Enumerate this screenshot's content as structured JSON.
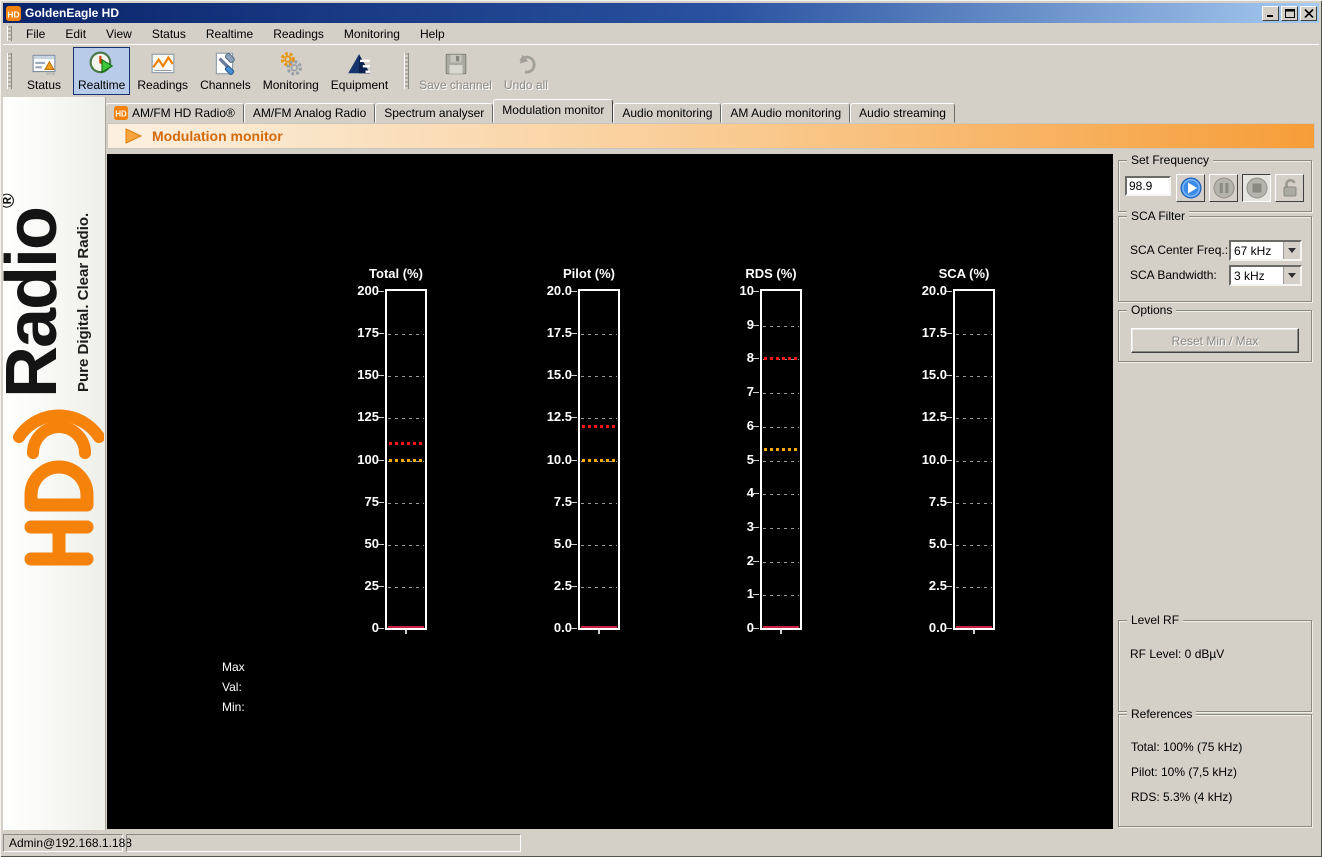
{
  "window": {
    "title": "GoldenEagle HD"
  },
  "menu": {
    "items": [
      "File",
      "Edit",
      "View",
      "Status",
      "Realtime",
      "Readings",
      "Monitoring",
      "Help"
    ]
  },
  "toolbar": {
    "buttons": [
      {
        "label": "Status",
        "icon": "status-icon",
        "active": false
      },
      {
        "label": "Realtime",
        "icon": "realtime-icon",
        "active": true
      },
      {
        "label": "Readings",
        "icon": "readings-icon",
        "active": false
      },
      {
        "label": "Channels",
        "icon": "channels-icon",
        "active": false
      },
      {
        "label": "Monitoring",
        "icon": "monitoring-icon",
        "active": false
      },
      {
        "label": "Equipment",
        "icon": "equipment-icon",
        "active": false
      }
    ],
    "actions": [
      {
        "label": "Save channel",
        "icon": "save-icon",
        "disabled": true
      },
      {
        "label": "Undo all",
        "icon": "undo-icon",
        "disabled": true
      }
    ]
  },
  "tabs": [
    {
      "label": "AM/FM HD Radio®",
      "active": false,
      "icon": "hd-icon"
    },
    {
      "label": "AM/FM Analog Radio",
      "active": false
    },
    {
      "label": "Spectrum analyser",
      "active": false
    },
    {
      "label": "Modulation monitor",
      "active": true
    },
    {
      "label": "Audio monitoring",
      "active": false
    },
    {
      "label": "AM Audio monitoring",
      "active": false
    },
    {
      "label": "Audio streaming",
      "active": false
    }
  ],
  "section_header": {
    "title": "Modulation monitor"
  },
  "branding": {
    "logo_text": "HD",
    "name": "Radio",
    "registered": "®",
    "tagline": "Pure Digital. Clear Radio."
  },
  "chart_data": [
    {
      "type": "bar",
      "title": "Total (%)",
      "ymin": 0,
      "ymax": 200,
      "tick_labels": [
        "200",
        "175",
        "150",
        "125",
        "100",
        "75",
        "50",
        "25",
        "0"
      ],
      "value": 0,
      "red_line": 110,
      "orange_line": 100
    },
    {
      "type": "bar",
      "title": "Pilot (%)",
      "ymin": 0,
      "ymax": 20,
      "tick_labels": [
        "20.0",
        "17.5",
        "15.0",
        "12.5",
        "10.0",
        "7.5",
        "5.0",
        "2.5",
        "0.0"
      ],
      "value": 0,
      "red_line": 12,
      "orange_line": 10
    },
    {
      "type": "bar",
      "title": "RDS (%)",
      "ymin": 0,
      "ymax": 10,
      "tick_labels": [
        "10",
        "9",
        "8",
        "7",
        "6",
        "5",
        "4",
        "3",
        "2",
        "1",
        "0"
      ],
      "value": 0,
      "red_line": 8,
      "orange_line": 5.3
    },
    {
      "type": "bar",
      "title": "SCA (%)",
      "ymin": 0,
      "ymax": 20,
      "tick_labels": [
        "20.0",
        "17.5",
        "15.0",
        "12.5",
        "10.0",
        "7.5",
        "5.0",
        "2.5",
        "0.0"
      ],
      "value": 0,
      "red_line": null,
      "orange_line": null
    }
  ],
  "meter_legend": {
    "max": "Max",
    "val": "Val:",
    "min": "Min:"
  },
  "set_frequency": {
    "group_label": "Set Frequency",
    "value": "98.9"
  },
  "sca_filter": {
    "group_label": "SCA Filter",
    "center_freq_label": "SCA Center Freq.:",
    "center_freq_value": "67 kHz",
    "bandwidth_label": "SCA Bandwidth:",
    "bandwidth_value": "3 kHz"
  },
  "options": {
    "group_label": "Options",
    "reset_label": "Reset Min / Max"
  },
  "level_rf": {
    "group_label": "Level RF",
    "text": "RF Level: 0 dBµV"
  },
  "references": {
    "group_label": "References",
    "lines": [
      "Total: 100% (75 kHz)",
      "Pilot: 10% (7,5 kHz)",
      "RDS: 5.3% (4 kHz)"
    ]
  },
  "status_bar": {
    "user": "Admin@192.168.1.188"
  },
  "colors": {
    "accent_orange": "#f5820a",
    "titlebar_start": "#0a246a",
    "titlebar_end": "#a6caf0",
    "meter_red": "#ff1414",
    "meter_orange": "#ffaa00",
    "value_bar": "#cc2244"
  }
}
